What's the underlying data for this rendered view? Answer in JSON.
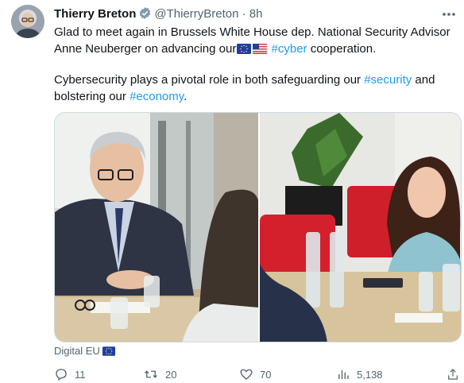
{
  "author": {
    "name": "Thierry Breton",
    "handle": "@ThierryBreton",
    "separator": "·",
    "time": "8h"
  },
  "tweet": {
    "line1_before": "Glad to meet again in Brussels White House dep. National Security Advisor Anne Neuberger on advancing our",
    "hashtag_cyber": "#cyber",
    "line1_after": " cooperation.",
    "line2_before": "Cybersecurity plays a pivotal role in both safeguarding our ",
    "hashtag_security": "#security",
    "line2_mid": " and bolstering our ",
    "hashtag_economy": "#economy",
    "line2_after": "."
  },
  "media_source": "Digital EU",
  "actions": {
    "replies": "11",
    "retweets": "20",
    "likes": "70",
    "views": "5,138"
  },
  "colors": {
    "accent": "#1d9bf0",
    "muted": "#536471",
    "text": "#0f1419"
  },
  "icons": [
    "verified-badge-icon",
    "more-icon",
    "eu-flag-icon",
    "us-flag-icon",
    "reply-icon",
    "retweet-icon",
    "like-icon",
    "views-icon",
    "share-icon"
  ]
}
